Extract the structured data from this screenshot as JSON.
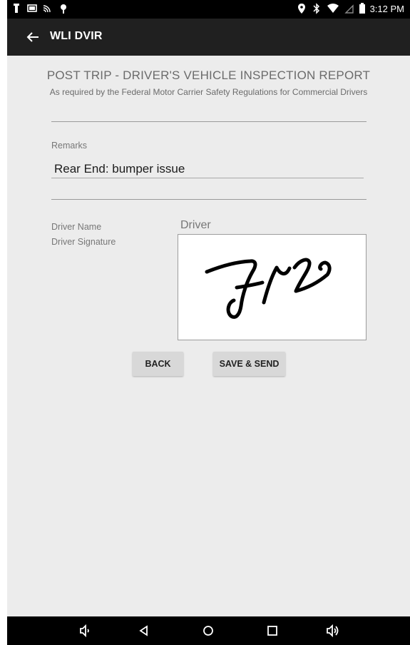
{
  "status_bar": {
    "time": "3:12 PM",
    "left_icons": [
      "usb-icon",
      "tablet-icon",
      "cast-icon",
      "location-pin-icon"
    ],
    "right_icons": [
      "location-icon",
      "bluetooth-icon",
      "wifi-icon",
      "no-signal-icon",
      "battery-icon"
    ]
  },
  "app_bar": {
    "title": "WLI DVIR",
    "back_icon": "arrow-back-icon"
  },
  "report": {
    "title": "POST TRIP - DRIVER'S VEHICLE INSPECTION REPORT",
    "subtitle": "As required by the Federal Motor Carrier Safety Regulations for Commercial Drivers"
  },
  "form": {
    "remarks_label": "Remarks",
    "remarks_value": "Rear End: bumper issue",
    "driver_name_label": "Driver Name",
    "driver_name_value": "Driver",
    "driver_signature_label": "Driver Signature"
  },
  "buttons": {
    "back": "BACK",
    "save_send": "SAVE & SEND"
  },
  "nav_bar": {
    "icons": [
      "volume-down-icon",
      "back-triangle-icon",
      "home-circle-icon",
      "recents-square-icon",
      "volume-up-icon"
    ]
  },
  "colors": {
    "app_bar": "#202020",
    "background": "#ececec",
    "button": "#d8d8d8"
  }
}
